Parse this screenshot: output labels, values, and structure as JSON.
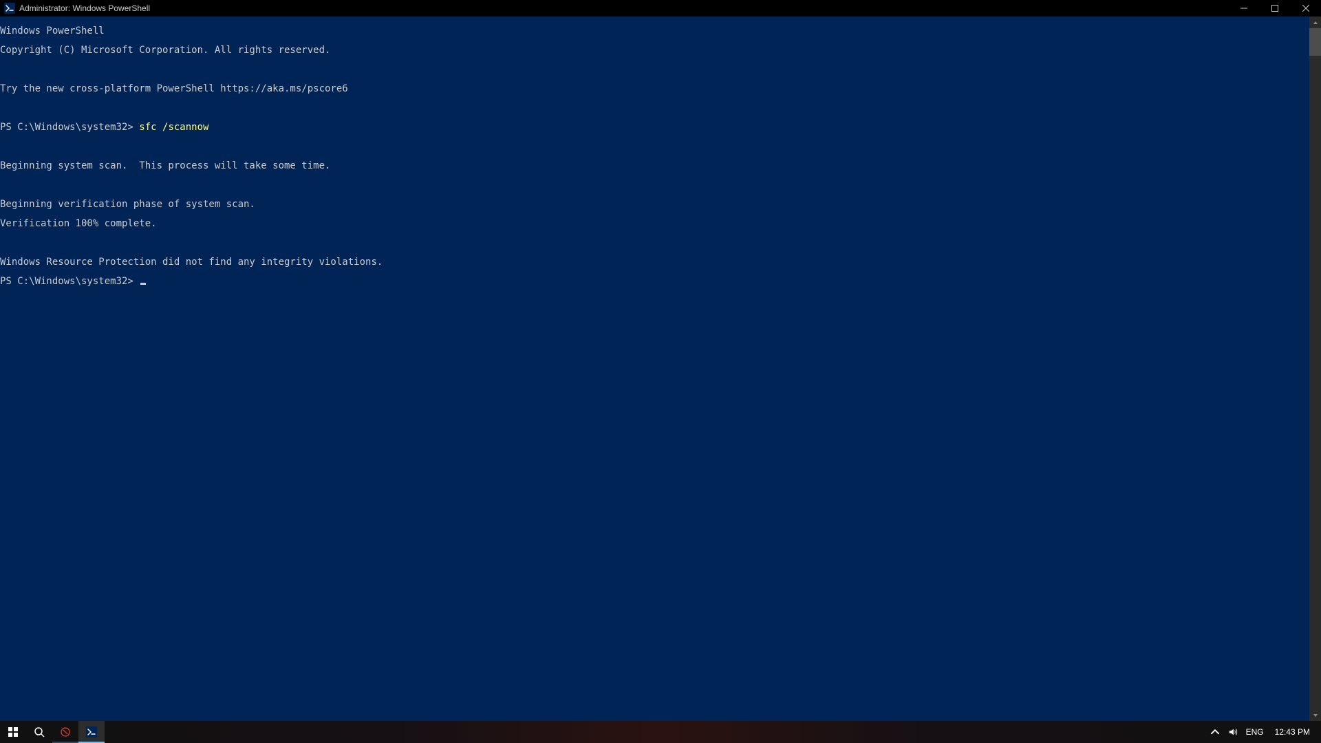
{
  "window": {
    "title": "Administrator: Windows PowerShell",
    "icon_name": "powershell-icon"
  },
  "colors": {
    "console_bg": "#012456",
    "console_fg": "#cccccc",
    "command_fg": "#ffff80"
  },
  "console": {
    "banner1": "Windows PowerShell",
    "banner2": "Copyright (C) Microsoft Corporation. All rights reserved.",
    "blank1": "",
    "try_ps": "Try the new cross-platform PowerShell https://aka.ms/pscore6",
    "blank2": "",
    "prompt1_prefix": "PS C:\\Windows\\system32> ",
    "prompt1_command": "sfc /scannow",
    "blank3": "",
    "scan_begin": "Beginning system scan.  This process will take some time.",
    "blank4": "",
    "verify_begin": "Beginning verification phase of system scan.",
    "verify_done": "Verification 100% complete.",
    "blank5": "",
    "result": "Windows Resource Protection did not find any integrity violations.",
    "prompt2_prefix": "PS C:\\Windows\\system32> "
  },
  "taskbar": {
    "start_name": "windows-start-icon",
    "search_name": "search-icon",
    "snip_name": "snip-sketch-icon",
    "powershell_name": "powershell-icon"
  },
  "systray": {
    "chevron_name": "chevron-up-icon",
    "volume_name": "volume-icon",
    "language": "ENG",
    "clock": "12:43 PM"
  }
}
